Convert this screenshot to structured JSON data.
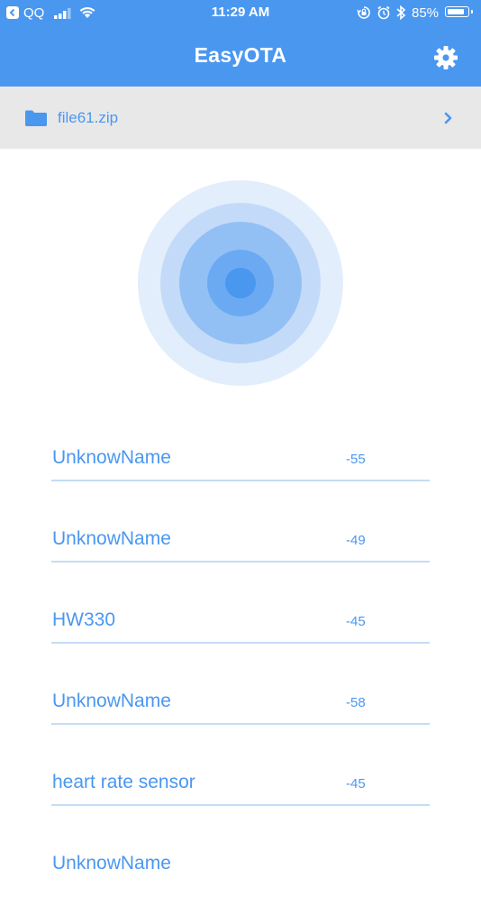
{
  "status_bar": {
    "carrier": "QQ",
    "time": "11:29 AM",
    "battery_percent": "85%",
    "battery_level": 0.85
  },
  "nav": {
    "title": "EasyOTA",
    "settings_icon": "gear-icon"
  },
  "file": {
    "name": "file61.zip",
    "icon": "folder-icon",
    "action_icon": "chevron-right-icon"
  },
  "colors": {
    "accent": "#4a97f0",
    "file_bar_bg": "#e8e8e8",
    "divider": "#c4dcf6"
  },
  "devices": [
    {
      "name": "UnknowName",
      "rssi": "-55"
    },
    {
      "name": "UnknowName",
      "rssi": "-49"
    },
    {
      "name": "HW330",
      "rssi": "-45"
    },
    {
      "name": "UnknowName",
      "rssi": "-58"
    },
    {
      "name": "heart rate sensor",
      "rssi": "-45"
    },
    {
      "name": "UnknowName",
      "rssi": ""
    }
  ]
}
